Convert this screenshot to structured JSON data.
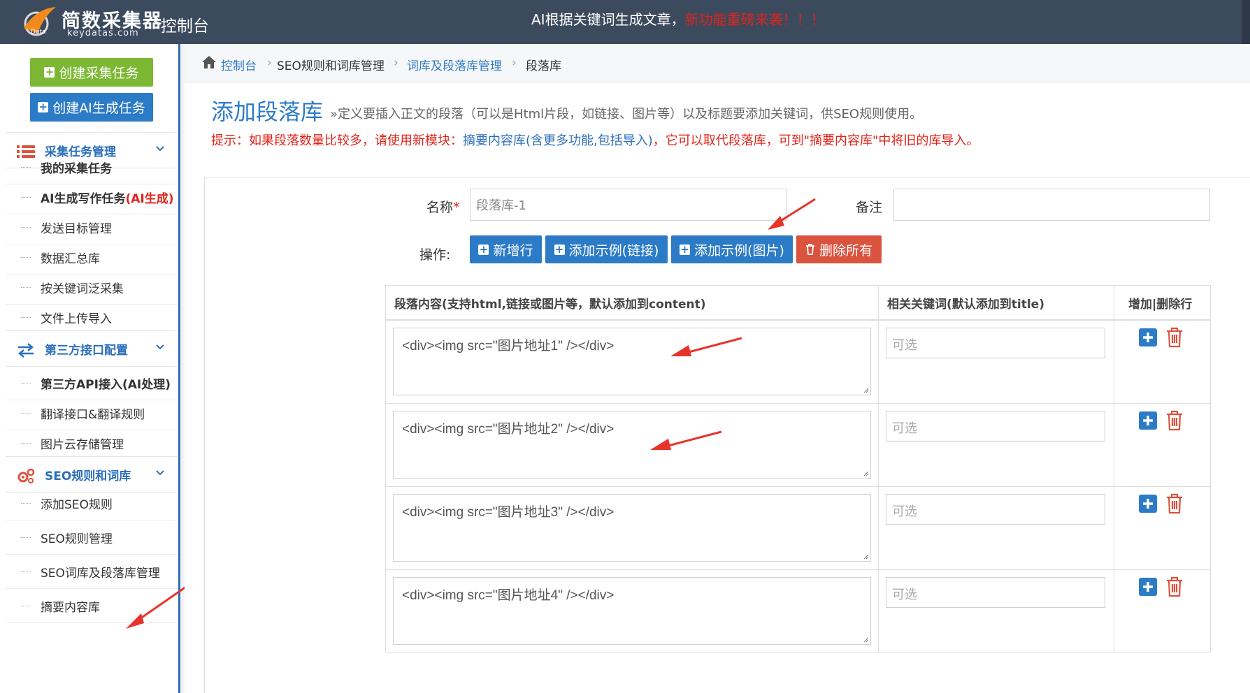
{
  "header": {
    "brand": "简数采集器",
    "brand_sub": "keydatas.com",
    "console_label": "控制台",
    "announce_white": "AI根据关键词生成文章，",
    "announce_red": "新功能重磅来袭！！！"
  },
  "sidebar": {
    "create_collect": "创建采集任务",
    "create_ai": "创建AI生成任务",
    "groups": [
      {
        "label": "采集任务管理",
        "icon": "list-icon",
        "items": [
          {
            "label": "我的采集任务",
            "suffix": ""
          },
          {
            "label": "AI生成写作任务",
            "suffix": "(AI生成)"
          },
          {
            "label": "发送目标管理",
            "suffix": ""
          },
          {
            "label": "数据汇总库",
            "suffix": ""
          },
          {
            "label": "按关键词泛采集",
            "suffix": ""
          },
          {
            "label": "文件上传导入",
            "suffix": ""
          }
        ]
      },
      {
        "label": "第三方接口配置",
        "icon": "exchange-icon",
        "items": [
          {
            "label": "第三方API接入(AI处理)",
            "suffix": ""
          },
          {
            "label": "翻译接口&翻译规则",
            "suffix": ""
          },
          {
            "label": "图片云存储管理",
            "suffix": ""
          }
        ]
      },
      {
        "label": "SEO规则和词库",
        "icon": "gears-icon",
        "items": [
          {
            "label": "添加SEO规则",
            "suffix": ""
          },
          {
            "label": "SEO规则管理",
            "suffix": ""
          },
          {
            "label": "SEO词库及段落库管理",
            "suffix": ""
          },
          {
            "label": "摘要内容库",
            "suffix": ""
          }
        ]
      }
    ]
  },
  "breadcrumb": [
    "控制台",
    "SEO规则和词库管理",
    "词库及段落库管理",
    "段落库"
  ],
  "page": {
    "title": "添加段落库",
    "desc": "»定义要插入正文的段落（可以是Html片段，如链接、图片等）以及标题要添加关键词，供SEO规则使用。",
    "tip_a": "提示：如果段落数量比较多，请使用新模块：",
    "tip_link": "摘要内容库(含更多功能,包括导入)",
    "tip_b": "，它可以取代段落库，可到\"摘要内容库\"中将旧的库导入。"
  },
  "form": {
    "name_label": "名称",
    "name_required_mark": "*",
    "name_value": "段落库-1",
    "note_label": "备注",
    "note_value": "",
    "ops_label": "操作:",
    "btn_add_row": "新增行",
    "btn_add_link": "添加示例(链接)",
    "btn_add_image": "添加示例(图片)",
    "btn_delete_all": "删除所有"
  },
  "table": {
    "headers": [
      "段落内容(支持html,链接或图片等，默认添加到content)",
      "相关关键词(默认添加到title)",
      "增加|删除行"
    ],
    "rows": [
      {
        "content": "<div><img src=\"图片地址1\" /></div>",
        "keyword_placeholder": "可选"
      },
      {
        "content": "<div><img src=\"图片地址2\" /></div>",
        "keyword_placeholder": "可选"
      },
      {
        "content": "<div><img src=\"图片地址3\" /></div>",
        "keyword_placeholder": "可选"
      },
      {
        "content": "<div><img src=\"图片地址4\" /></div>",
        "keyword_placeholder": "可选"
      }
    ]
  },
  "colors": {
    "header_bg": "#3c4a5d",
    "primary": "#2c7bc7",
    "green": "#7cb833",
    "danger": "#d9533f",
    "red_text": "#e2231a",
    "annotation_arrow": "#e8332a"
  }
}
